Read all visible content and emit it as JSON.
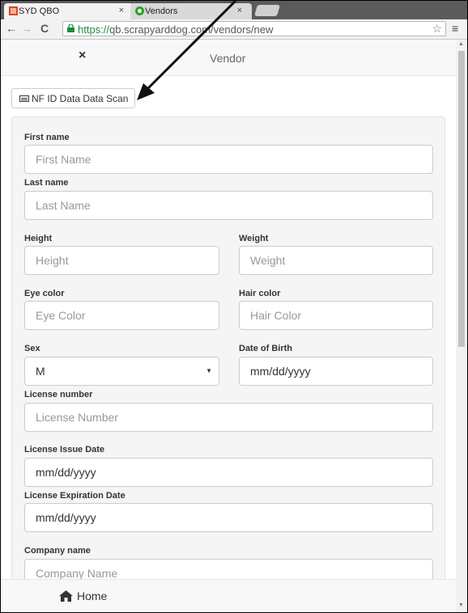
{
  "browser": {
    "tabs": [
      {
        "title": "SYD QBO",
        "close": "×",
        "favicon": "syd-favicon"
      },
      {
        "title": "Vendors",
        "close": "×",
        "favicon": "vendors-favicon"
      }
    ],
    "nav": {
      "back": "←",
      "forward": "→",
      "reload": "C"
    },
    "url_scheme": "https://",
    "url_rest": "qb.scrapyarddog.com/vendors/new",
    "star": "☆",
    "menu": "≡"
  },
  "header": {
    "close_icon": "×",
    "title": "Vendor"
  },
  "scan_button": {
    "label": "NF ID Data Data Scan",
    "icon": "id-card-icon"
  },
  "form": {
    "first_name": {
      "label": "First name",
      "placeholder": "First Name"
    },
    "last_name": {
      "label": "Last name",
      "placeholder": "Last Name"
    },
    "height": {
      "label": "Height",
      "placeholder": "Height"
    },
    "weight": {
      "label": "Weight",
      "placeholder": "Weight"
    },
    "eye_color": {
      "label": "Eye color",
      "placeholder": "Eye Color"
    },
    "hair_color": {
      "label": "Hair color",
      "placeholder": "Hair Color"
    },
    "sex": {
      "label": "Sex",
      "value": "M"
    },
    "dob": {
      "label": "Date of Birth",
      "value": "mm/dd/yyyy"
    },
    "license_number": {
      "label": "License number",
      "placeholder": "License Number"
    },
    "license_issue": {
      "label": "License Issue Date",
      "value": "mm/dd/yyyy"
    },
    "license_exp": {
      "label": "License Expiration Date",
      "value": "mm/dd/yyyy"
    },
    "company_name": {
      "label": "Company name",
      "placeholder": "Company Name"
    }
  },
  "footer": {
    "home_label": "Home",
    "home_icon": "home-icon"
  },
  "colors": {
    "secure_green": "#1e8c3a",
    "well_bg": "#f5f5f5",
    "tabstrip": "#5b5b5b"
  }
}
